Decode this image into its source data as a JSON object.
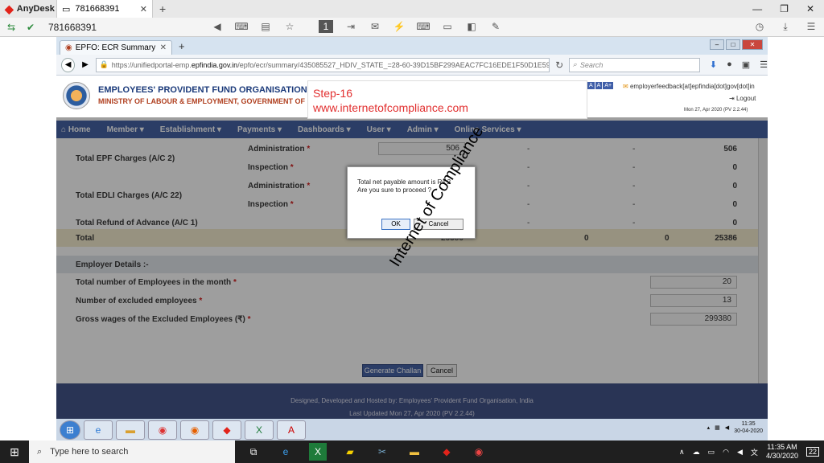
{
  "anydesk": {
    "app_name": "AnyDesk",
    "tab_label": "781668391",
    "address": "781668391"
  },
  "browser": {
    "tab_title": "EPFO: ECR Summary",
    "url_prefix": "https://unifiedportal-emp.",
    "url_host": "epfindia.gov.in",
    "url_path": "/epfo/ecr/summary/435085527_HDIV_STATE_=28-60-39D15BF299AEAC7FC16EDE1F50D1E59B",
    "search_placeholder": "Search"
  },
  "header": {
    "org_name": "EMPLOYEES' PROVIDENT FUND ORGANISATION, INDIA",
    "ministry": "MINISTRY OF LABOUR & EMPLOYMENT, GOVERNMENT OF INDIA",
    "font_buttons": [
      "A",
      "A",
      "A+"
    ],
    "feedback_email": "employerfeedback[at]epfindia[dot]gov[dot]in",
    "logout": "Logout",
    "last_login": "Mon 27, Apr 2020 (PV 2.2.44)"
  },
  "annotation": {
    "step": "Step-16",
    "site": "www.internetofcompliance.com",
    "watermark": "Internet of Compliance"
  },
  "menu": [
    "Home",
    "Member",
    "Establishment",
    "Payments",
    "Dashboards",
    "User",
    "Admin",
    "Online Services"
  ],
  "charges": {
    "epf_label": "Total EPF Charges (A/C 2)",
    "edli_label": "Total EDLI Charges (A/C 22)",
    "refund_label": "Total Refund of Advance (A/C 1)",
    "total_label": "Total",
    "administration": "Administration",
    "inspection": "Inspection",
    "req": "*",
    "epf_admin_input": "506",
    "dash": "-",
    "epf_admin_total": "506",
    "zero": "0",
    "total_c0": "25386",
    "total_c1": "0",
    "total_c2": "0",
    "total_c3": "25386"
  },
  "employer": {
    "section_label": "Employer Details :-",
    "employees_label": "Total number of Employees in the month",
    "employees_value": "20",
    "excluded_label": "Number of excluded employees",
    "excluded_value": "13",
    "gross_label": "Gross wages of the Excluded Employees (₹)",
    "gross_value": "299380"
  },
  "actions": {
    "generate": "Generate Challan",
    "cancel": "Cancel"
  },
  "dialog": {
    "line1": "Total net payable amount is Rs 2",
    "line2": "Are you sure to proceed ?",
    "ok": "OK",
    "cancel": "Cancel"
  },
  "footer": {
    "line1": "Designed, Developed and Hosted by: Employees' Provident Fund Organisation, India",
    "line2": "Last Updated Mon 27, Apr 2020 (PV 2.2.44)"
  },
  "remote_taskbar": {
    "time": "11:35",
    "date": "30-04-2020"
  },
  "host_taskbar": {
    "search_placeholder": "Type here to search",
    "time": "11:35 AM",
    "date": "4/30/2020",
    "notification_count": "22"
  }
}
